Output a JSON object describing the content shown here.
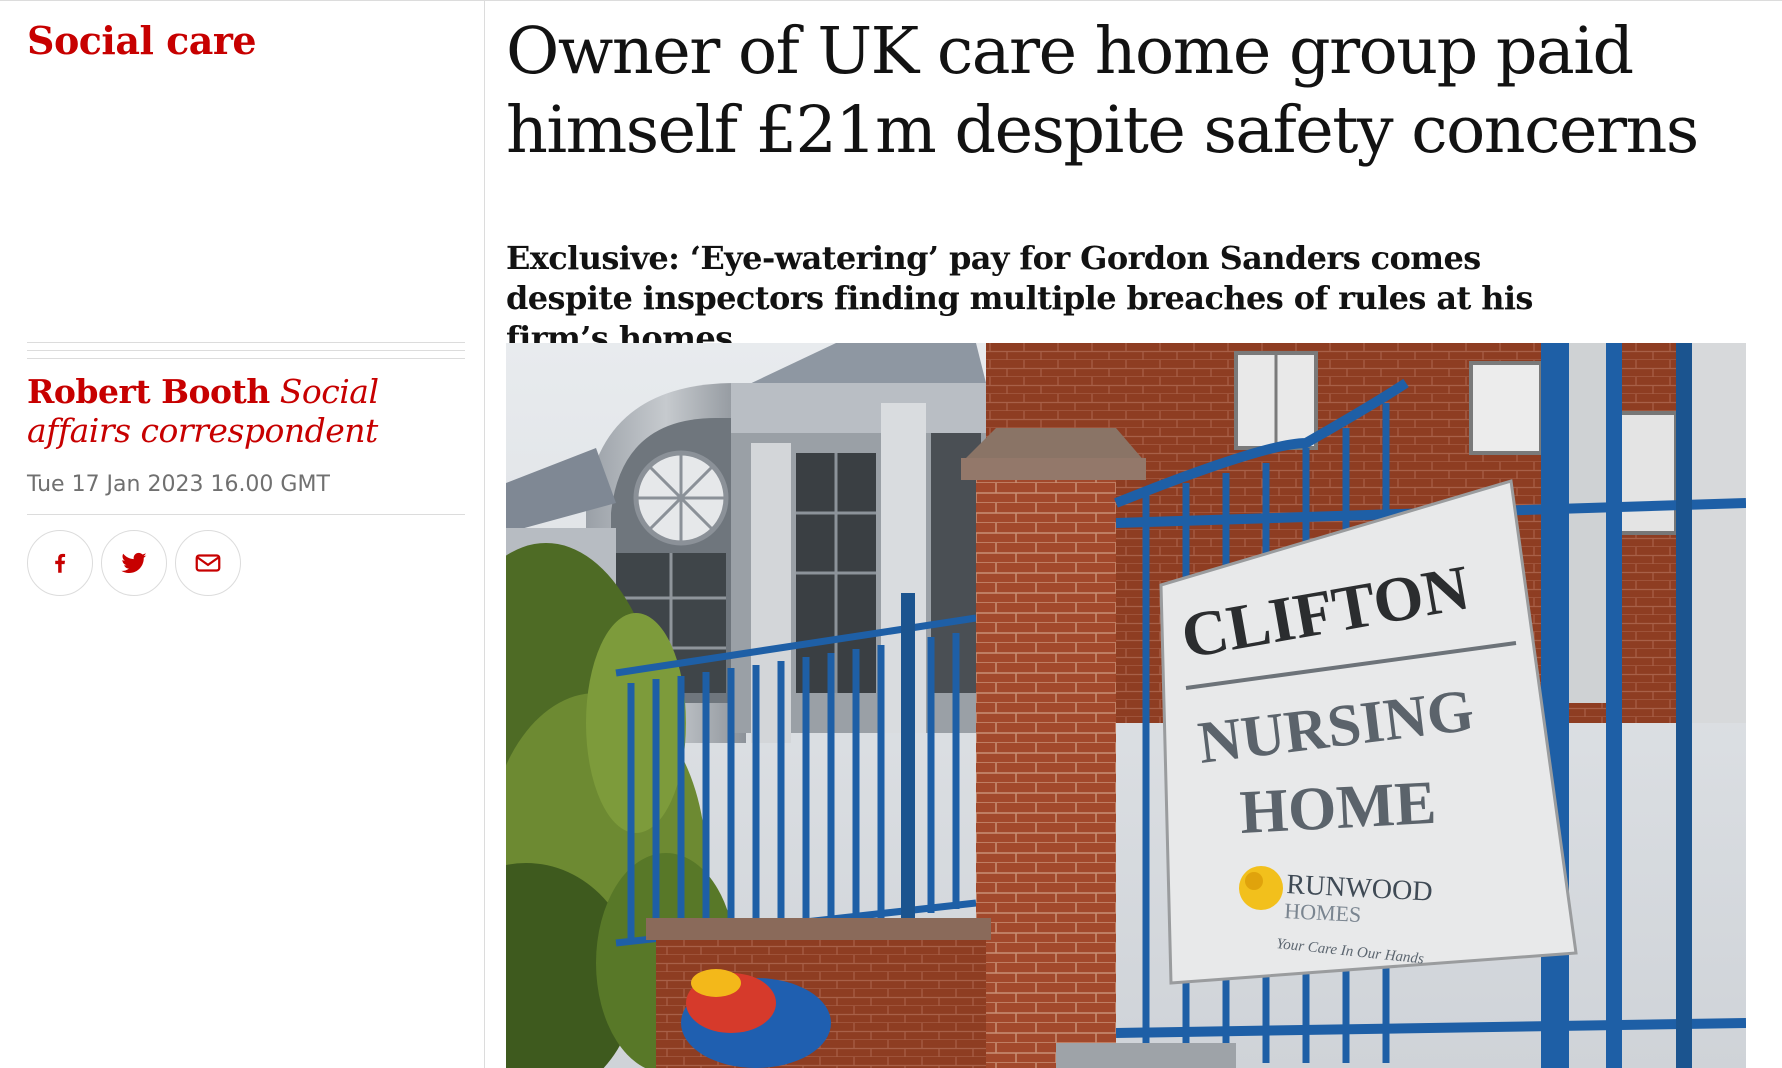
{
  "section": {
    "label": "Social care"
  },
  "article": {
    "headline": "Owner of UK care home group paid himself £21m despite safety concerns",
    "standfirst": "Exclusive: ‘Eye-watering’ pay for Gordon Sanders comes despite inspectors finding multiple breaches of rules at his firm’s homes"
  },
  "byline": {
    "name": "Robert Booth",
    "role": "Social affairs correspondent",
    "date": "Tue 17 Jan 2023 16.00 GMT"
  },
  "share": {
    "icons": [
      "facebook-icon",
      "twitter-icon",
      "email-icon"
    ]
  },
  "photo": {
    "sign_line1": "CLIFTON",
    "sign_line2": "NURSING",
    "sign_line3": "HOME",
    "logo_line1": "RUNWOOD",
    "logo_line2": "HOMES",
    "logo_tagline": "Your Care In Our Hands"
  },
  "colors": {
    "accent": "#c70000",
    "text": "#121212",
    "muted": "#707070",
    "rule": "#dcdcdc",
    "gate_blue": "#1e5fa6"
  }
}
